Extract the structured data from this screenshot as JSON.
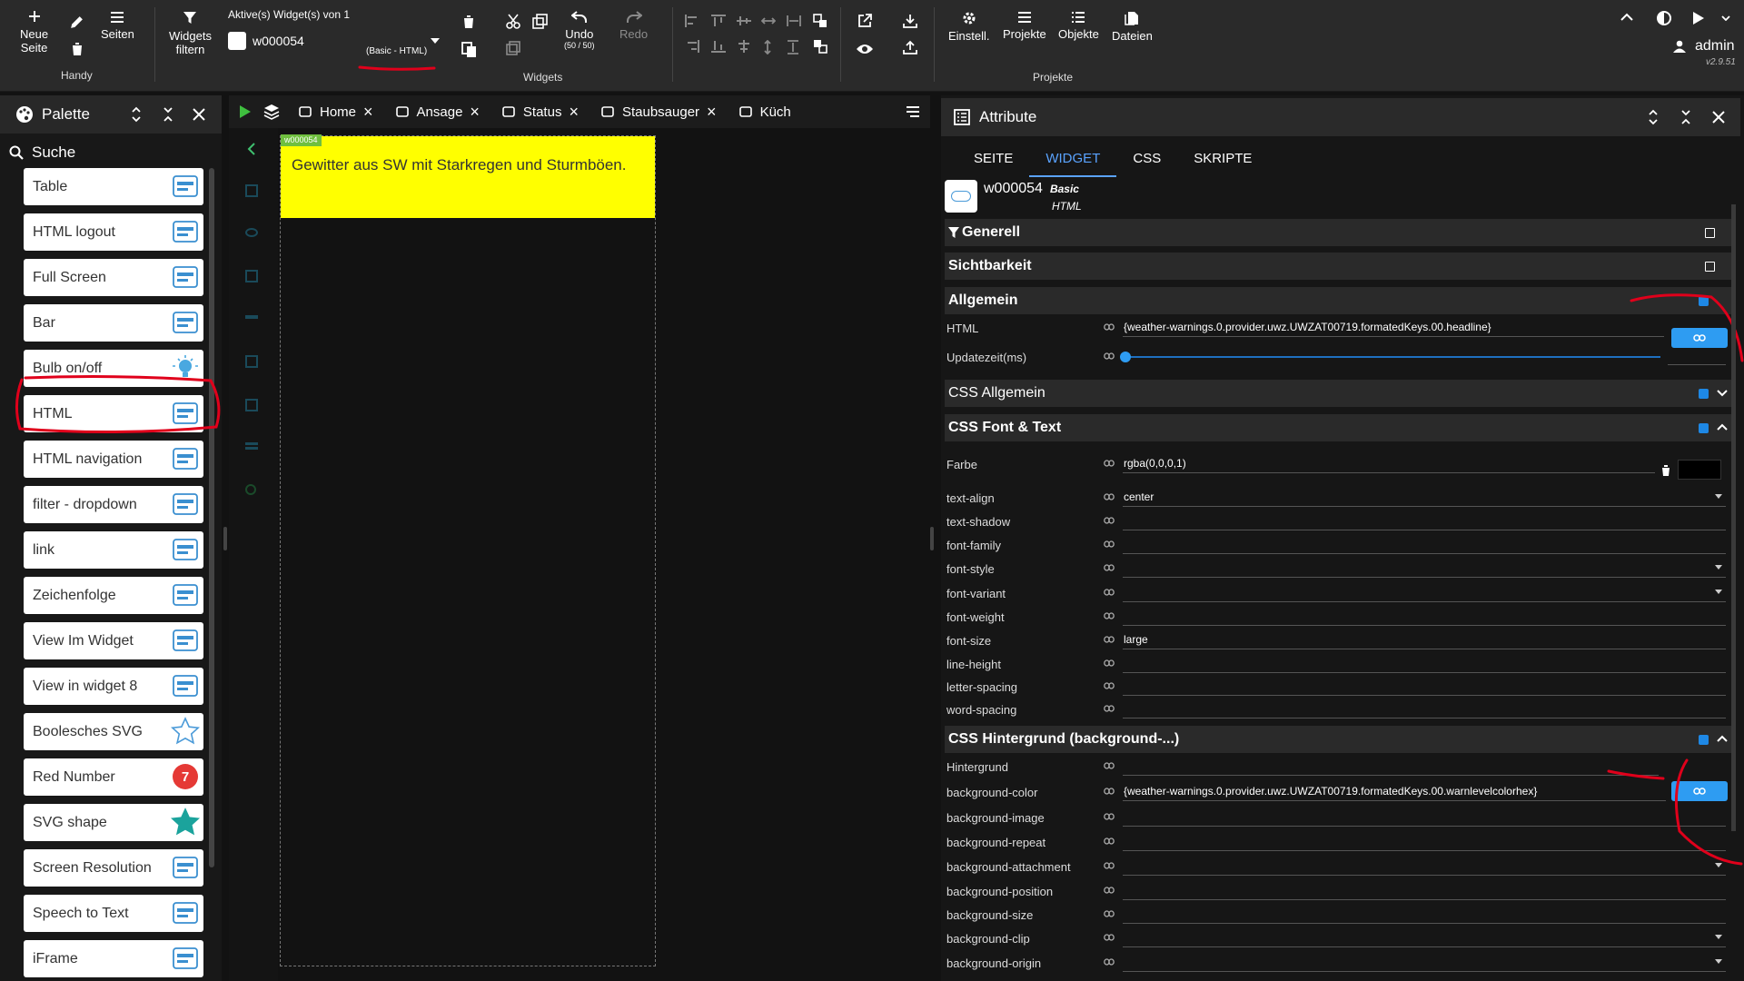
{
  "toolbar": {
    "new_page_l1": "Neue",
    "new_page_l2": "Seite",
    "pages": "Seiten",
    "handy": "Handy",
    "filter_l1": "Widgets",
    "filter_l2": "filtern",
    "active_label": "Aktive(s) Widget(s) von 1",
    "active_widget": "w000054",
    "active_type": "(Basic - HTML)",
    "undo": "Undo",
    "undo_count": "(50 / 50)",
    "redo": "Redo",
    "widgets_group": "Widgets",
    "settings": "Einstell.",
    "projects": "Projekte",
    "objects": "Objekte",
    "files": "Dateien",
    "projects_group": "Projekte",
    "user": "admin",
    "version": "v2.9.51"
  },
  "palette": {
    "title": "Palette",
    "search": "Suche",
    "items": [
      {
        "label": "Table",
        "icon": "table-icon"
      },
      {
        "label": "HTML logout",
        "icon": "logout-icon"
      },
      {
        "label": "Full Screen",
        "icon": "fullscreen-icon"
      },
      {
        "label": "Bar",
        "icon": "bar-icon"
      },
      {
        "label": "Bulb on/off",
        "icon": "bulb-icon"
      },
      {
        "label": "HTML",
        "icon": "html-icon"
      },
      {
        "label": "HTML navigation",
        "icon": "html-navigation-icon"
      },
      {
        "label": "filter - dropdown",
        "icon": "filter-dropdown-icon"
      },
      {
        "label": "link",
        "icon": "link-icon"
      },
      {
        "label": "Zeichenfolge",
        "icon": "text-icon"
      },
      {
        "label": "View Im Widget",
        "icon": "view-widget-icon"
      },
      {
        "label": "View in widget 8",
        "icon": "view-widget-8-icon"
      },
      {
        "label": "Boolesches SVG",
        "icon": "star-outline-icon"
      },
      {
        "label": "Red Number",
        "icon": "red-number-icon",
        "badge": "7"
      },
      {
        "label": "SVG shape",
        "icon": "star-filled-icon"
      },
      {
        "label": "Screen Resolution",
        "icon": "screen-resolution-icon"
      },
      {
        "label": "Speech to Text",
        "icon": "speech-icon"
      },
      {
        "label": "iFrame",
        "icon": "iframe-icon"
      }
    ]
  },
  "tabs": [
    {
      "label": "Home",
      "icon": "home-icon"
    },
    {
      "label": "Ansage",
      "icon": "speaker-icon"
    },
    {
      "label": "Status",
      "icon": "status-icon"
    },
    {
      "label": "Staubsauger",
      "icon": "vacuum-icon"
    },
    {
      "label": "Küch",
      "icon": "kitchen-icon"
    }
  ],
  "canvas": {
    "widget_tag": "w000054",
    "widget_text": "Gewitter aus SW mit Starkregen und Sturmböen.",
    "widget_color": "#ffff00"
  },
  "attributes": {
    "title": "Attribute",
    "tabs": [
      "SEITE",
      "WIDGET",
      "CSS",
      "SKRIPTE"
    ],
    "widget_id": "w000054",
    "widget_set": "Basic",
    "widget_type": "HTML",
    "sections": {
      "generell": "Generell",
      "sichtbarkeit": "Sichtbarkeit",
      "allgemein": "Allgemein",
      "css_allgemein": "CSS Allgemein",
      "css_font": "CSS Font & Text",
      "css_bg": "CSS Hintergrund (background-...)"
    },
    "allgemein_rows": [
      {
        "label": "HTML",
        "value": "{weather-warnings.0.provider.uwz.UWZAT00719.formatedKeys.00.headline}"
      },
      {
        "label": "Updatezeit(ms)",
        "value": ""
      }
    ],
    "font_rows": [
      {
        "label": "Farbe",
        "value": "rgba(0,0,0,1)"
      },
      {
        "label": "text-align",
        "value": "center"
      },
      {
        "label": "text-shadow",
        "value": ""
      },
      {
        "label": "font-family",
        "value": ""
      },
      {
        "label": "font-style",
        "value": ""
      },
      {
        "label": "font-variant",
        "value": ""
      },
      {
        "label": "font-weight",
        "value": ""
      },
      {
        "label": "font-size",
        "value": "large"
      },
      {
        "label": "line-height",
        "value": ""
      },
      {
        "label": "letter-spacing",
        "value": ""
      },
      {
        "label": "word-spacing",
        "value": ""
      }
    ],
    "bg_rows": [
      {
        "label": "Hintergrund",
        "value": ""
      },
      {
        "label": "background-color",
        "value": "{weather-warnings.0.provider.uwz.UWZAT00719.formatedKeys.00.warnlevelcolorhex}"
      },
      {
        "label": "background-image",
        "value": ""
      },
      {
        "label": "background-repeat",
        "value": ""
      },
      {
        "label": "background-attachment",
        "value": ""
      },
      {
        "label": "background-position",
        "value": ""
      },
      {
        "label": "background-size",
        "value": ""
      },
      {
        "label": "background-clip",
        "value": ""
      },
      {
        "label": "background-origin",
        "value": ""
      }
    ]
  },
  "colors": {
    "accent": "#2e9cf2",
    "widget_bg": "#ffff00",
    "annotation": "#e0001b"
  }
}
